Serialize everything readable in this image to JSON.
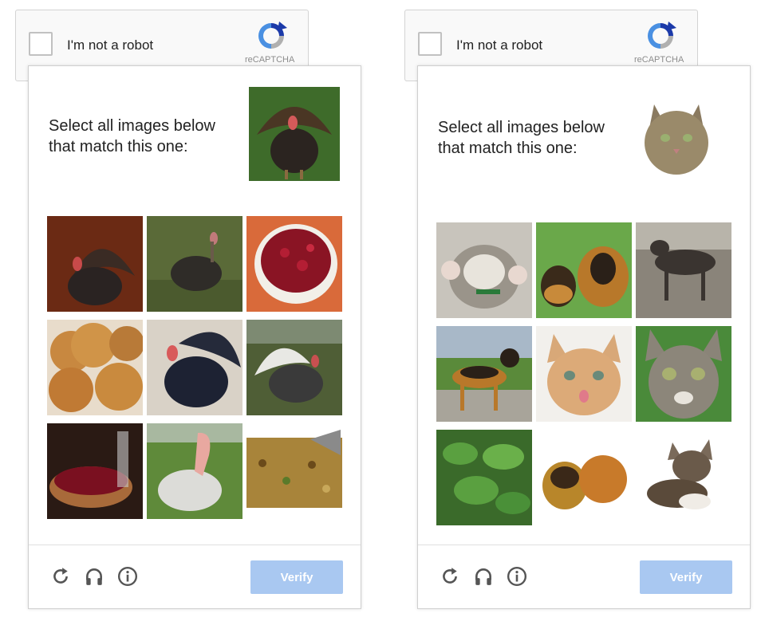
{
  "widgets": [
    {
      "anchor": {
        "label": "I'm not a robot",
        "brand": "reCAPTCHA"
      },
      "challenge": {
        "instruction": "Select all images below that match this one:",
        "sample_subject": "turkey",
        "tiles": [
          "turkey",
          "turkey",
          "cranberry-sauce",
          "bread-rolls",
          "turkey",
          "turkey",
          "cranberries-pot",
          "turkey",
          "stuffing"
        ],
        "verify_label": "Verify"
      }
    },
    {
      "anchor": {
        "label": "I'm not a robot",
        "brand": "reCAPTCHA"
      },
      "challenge": {
        "instruction": "Select all images below that match this one:",
        "sample_subject": "cat",
        "tiles": [
          "kitten",
          "german-shepherd-puppies",
          "dog",
          "german-shepherd",
          "kitten",
          "kitten",
          "catnip-plant",
          "guinea-pigs",
          "kitten"
        ],
        "verify_label": "Verify"
      }
    }
  ],
  "colors": {
    "verify_bg": "#a9c8f1",
    "logo_blue": "#4a90e2",
    "logo_dark": "#1c3aa9",
    "logo_gray": "#b0b0b0"
  },
  "icons": [
    "reload-icon",
    "audio-headphones-icon",
    "info-icon",
    "recaptcha-logo-icon"
  ]
}
